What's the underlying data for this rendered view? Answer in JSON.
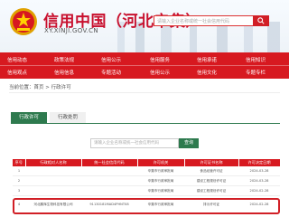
{
  "header": {
    "title": "信用中国（河北辛集）",
    "url": "XY.XINJI.GOV.CN",
    "search_placeholder": "请输入企业名称或统一社会信用代码"
  },
  "nav": {
    "row1": [
      "信用动态",
      "政策法规",
      "信用公示",
      "信用服务",
      "信用承诺",
      "信用知识"
    ],
    "row2": [
      "信用观点",
      "信用信息",
      "专题活动",
      "信用公示",
      "信用文化",
      "专题专栏"
    ]
  },
  "breadcrumb": "当前位置：首页 > 行政许可",
  "tabs": {
    "active": "行政许可",
    "inactive": "行政处罚"
  },
  "inner_search": {
    "placeholder": "请输入企业名称或统一社会信用代码",
    "button": "查询"
  },
  "table": {
    "headers": [
      "序号",
      "行政相对人名称",
      "统一社会信用代码",
      "许可机关",
      "许可证书名称",
      "许可决定日期"
    ],
    "rows": [
      [
        "1",
        "",
        "",
        "辛集市行政审批局",
        "食品经营许可证",
        "2024-03-28"
      ],
      [
        "2",
        "",
        "",
        "辛集市行政审批局",
        "建设工程规划许可证",
        "2024-03-28"
      ],
      [
        "3",
        "",
        "",
        "辛集市行政审批局",
        "建设工程规划许可证",
        "2024-02-28"
      ],
      [
        "4",
        "河北鹏辉生物科技有限公司",
        "91130181MAD4PHNT08",
        "辛集市行政审批局",
        "排污许可证",
        "2024-02-28"
      ]
    ]
  },
  "colors": {
    "brand_red": "#d71920",
    "tab_green": "#2e7a4e",
    "highlight": "#d11f26"
  }
}
